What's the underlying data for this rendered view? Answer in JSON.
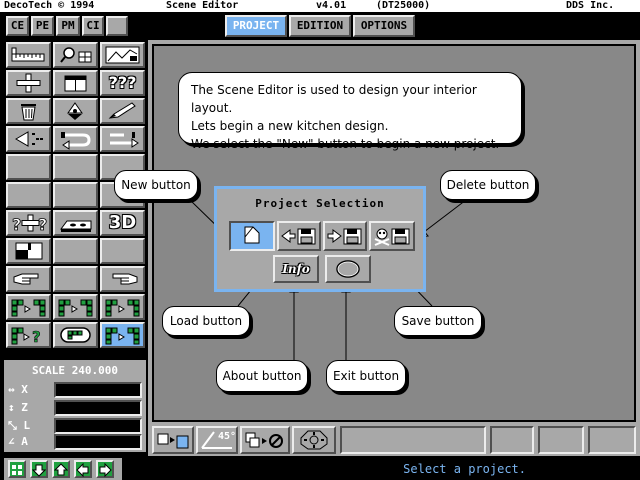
{
  "titlebar": {
    "app": "DecoTech © 1994",
    "window": "Scene Editor",
    "version": "v4.01",
    "code": "(DT25000)",
    "company": "DDS Inc."
  },
  "category_tabs": [
    "CE",
    "PE",
    "PM",
    "CI"
  ],
  "mode_buttons": [
    {
      "label": "PROJECT",
      "active": true
    },
    {
      "label": "EDITION",
      "active": false
    },
    {
      "label": "OPTIONS",
      "active": false
    }
  ],
  "intro": {
    "lines": [
      "The Scene Editor is used to design your interior layout.",
      "Lets begin a new kitchen design.",
      "We select the \"New\" button to begin a new project."
    ]
  },
  "dialog": {
    "title": "Project Selection",
    "info_label": "Info"
  },
  "callouts": {
    "new": "New button",
    "delete": "Delete button",
    "load": "Load button",
    "save": "Save button",
    "about": "About button",
    "exit": "Exit button"
  },
  "palette_labels": {
    "question": "???",
    "threed": "3D"
  },
  "scale": {
    "title": "SCALE",
    "value": "240.000",
    "rows": [
      "X",
      "Z",
      "L",
      "A"
    ]
  },
  "bottom_toolbar": {
    "angle": "45°"
  },
  "status": "Select a project.",
  "colors": {
    "accent": "#7ab4f0",
    "panel": "#a8a8a8",
    "workspace": "#888888",
    "green": "#20a040"
  }
}
